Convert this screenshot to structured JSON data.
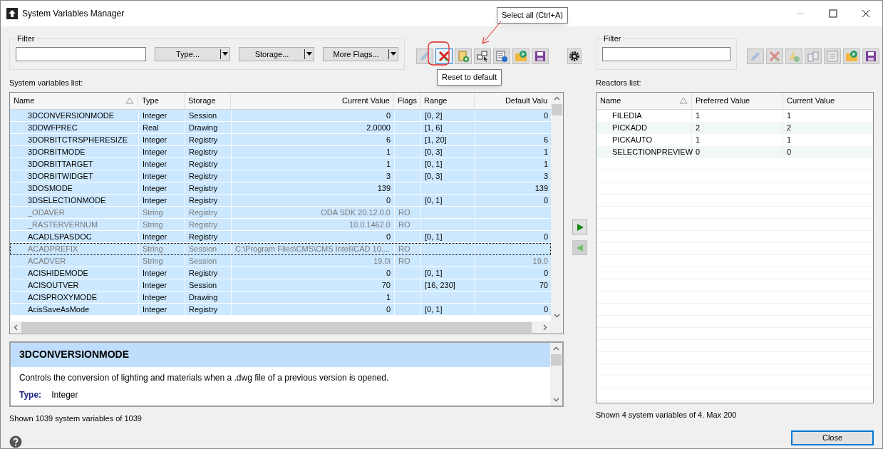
{
  "window": {
    "title": "System Variables Manager"
  },
  "filter": {
    "label": "Filter",
    "dropdowns": [
      "Type...",
      "Storage...",
      "More Flags..."
    ]
  },
  "toolbar": [
    {
      "kind": "edit",
      "disabled": true,
      "highlighted": false
    },
    {
      "kind": "reset",
      "disabled": false,
      "highlighted": true
    },
    {
      "kind": "paste-add",
      "disabled": false,
      "highlighted": false
    },
    {
      "kind": "select-all",
      "disabled": false,
      "highlighted": false
    },
    {
      "kind": "info",
      "disabled": false,
      "highlighted": false
    },
    {
      "kind": "export",
      "disabled": false,
      "highlighted": false
    },
    {
      "kind": "save",
      "disabled": false,
      "highlighted": false
    }
  ],
  "settings_button": {
    "kind": "settings"
  },
  "tooltips": [
    "Select all (Ctrl+A)",
    "Reset to default"
  ],
  "variables_list": {
    "label": "System variables list:",
    "columns": [
      "Name",
      "Type",
      "Storage",
      "Current Value",
      "Flags",
      "Range",
      "Default Valu"
    ],
    "rows": [
      {
        "name": "3DCONVERSIONMODE",
        "type": "Integer",
        "storage": "Session",
        "current_value": "0",
        "flags": "",
        "range": "[0, 2]",
        "default_value": "0",
        "dimmed": false,
        "focused": false,
        "selected": true
      },
      {
        "name": "3DDWFPREC",
        "type": "Real",
        "storage": "Drawing",
        "current_value": "2.0000",
        "flags": "",
        "range": "[1, 6]",
        "default_value": "",
        "dimmed": false,
        "focused": false,
        "selected": true
      },
      {
        "name": "3DORBITCTRSPHERESIZE",
        "type": "Integer",
        "storage": "Registry",
        "current_value": "6",
        "flags": "",
        "range": "[1, 20]",
        "default_value": "6",
        "dimmed": false,
        "focused": false,
        "selected": true
      },
      {
        "name": "3DORBITMODE",
        "type": "Integer",
        "storage": "Registry",
        "current_value": "1",
        "flags": "",
        "range": "[0, 3]",
        "default_value": "1",
        "dimmed": false,
        "focused": false,
        "selected": true
      },
      {
        "name": "3DORBITTARGET",
        "type": "Integer",
        "storage": "Registry",
        "current_value": "1",
        "flags": "",
        "range": "[0, 1]",
        "default_value": "1",
        "dimmed": false,
        "focused": false,
        "selected": true
      },
      {
        "name": "3DORBITWIDGET",
        "type": "Integer",
        "storage": "Registry",
        "current_value": "3",
        "flags": "",
        "range": "[0, 3]",
        "default_value": "3",
        "dimmed": false,
        "focused": false,
        "selected": true
      },
      {
        "name": "3DOSMODE",
        "type": "Integer",
        "storage": "Registry",
        "current_value": "139",
        "flags": "",
        "range": "",
        "default_value": "139",
        "dimmed": false,
        "focused": false,
        "selected": true
      },
      {
        "name": "3DSELECTIONMODE",
        "type": "Integer",
        "storage": "Registry",
        "current_value": "0",
        "flags": "",
        "range": "[0, 1]",
        "default_value": "0",
        "dimmed": false,
        "focused": false,
        "selected": true
      },
      {
        "name": "_ODAVER",
        "type": "String",
        "storage": "Registry",
        "current_value": "ODA SDK 20.12.0.0",
        "flags": "RO",
        "range": "",
        "default_value": "",
        "dimmed": true,
        "focused": false,
        "selected": true
      },
      {
        "name": "_RASTERVERNUM",
        "type": "String",
        "storage": "Registry",
        "current_value": "10.0.1462.0",
        "flags": "RO",
        "range": "",
        "default_value": "",
        "dimmed": true,
        "focused": false,
        "selected": true
      },
      {
        "name": "ACADLSPASDOC",
        "type": "Integer",
        "storage": "Registry",
        "current_value": "0",
        "flags": "",
        "range": "[0, 1]",
        "default_value": "0",
        "dimmed": false,
        "focused": false,
        "selected": true
      },
      {
        "name": "ACADPREFIX",
        "type": "String",
        "storage": "Session",
        "current_value": "C:\\Program Files\\CMS\\CMS IntelliCAD 10....",
        "flags": "RO",
        "range": "",
        "default_value": "",
        "dimmed": true,
        "focused": true,
        "selected": true
      },
      {
        "name": "ACADVER",
        "type": "String",
        "storage": "Session",
        "current_value": "19.0i",
        "flags": "RO",
        "range": "",
        "default_value": "19.0",
        "dimmed": true,
        "focused": false,
        "selected": true
      },
      {
        "name": "ACISHIDEMODE",
        "type": "Integer",
        "storage": "Registry",
        "current_value": "0",
        "flags": "",
        "range": "[0, 1]",
        "default_value": "0",
        "dimmed": false,
        "focused": false,
        "selected": true
      },
      {
        "name": "ACISOUTVER",
        "type": "Integer",
        "storage": "Session",
        "current_value": "70",
        "flags": "",
        "range": "[16, 230]",
        "default_value": "70",
        "dimmed": false,
        "focused": false,
        "selected": true
      },
      {
        "name": "ACISPROXYMODE",
        "type": "Integer",
        "storage": "Drawing",
        "current_value": "1",
        "flags": "",
        "range": "",
        "default_value": "",
        "dimmed": false,
        "focused": false,
        "selected": true
      },
      {
        "name": "AcisSaveAsMode",
        "type": "Integer",
        "storage": "Registry",
        "current_value": "0",
        "flags": "",
        "range": "[0, 1]",
        "default_value": "0",
        "dimmed": false,
        "focused": false,
        "selected": true
      }
    ]
  },
  "description": {
    "title": "3DCONVERSIONMODE",
    "text": "Controls the conversion of lighting and materials when a .dwg file of a previous version is opened.",
    "type_label": "Type:",
    "type_value": "Integer"
  },
  "status": "Shown 1039 system variables of 1039",
  "reactors": {
    "filter_label": "Filter",
    "toolbar": [
      {
        "kind": "edit",
        "disabled": true,
        "highlighted": false
      },
      {
        "kind": "reset",
        "disabled": true,
        "highlighted": false
      },
      {
        "kind": "warning-check",
        "disabled": true,
        "highlighted": false
      },
      {
        "kind": "copy",
        "disabled": true,
        "highlighted": false
      },
      {
        "kind": "list",
        "disabled": true,
        "highlighted": false
      },
      {
        "kind": "export",
        "disabled": false,
        "highlighted": false
      },
      {
        "kind": "save",
        "disabled": false,
        "highlighted": false
      }
    ],
    "label": "Reactors list:",
    "columns": [
      "Name",
      "Preferred Value",
      "Current Value"
    ],
    "rows": [
      {
        "name": "FILEDIA",
        "preferred_value": "1",
        "current_value": "1"
      },
      {
        "name": "PICKADD",
        "preferred_value": "2",
        "current_value": "2"
      },
      {
        "name": "PICKAUTO",
        "preferred_value": "1",
        "current_value": "1"
      },
      {
        "name": "SELECTIONPREVIEW",
        "preferred_value": "0",
        "current_value": "0"
      }
    ],
    "status": "Shown 4 system variables of 4. Max 200"
  },
  "close_button": "Close"
}
